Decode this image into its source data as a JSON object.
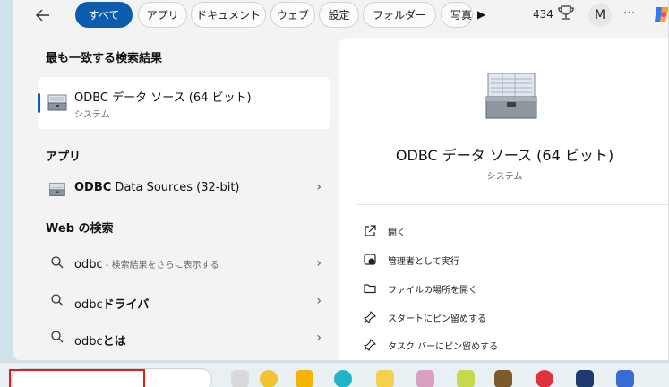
{
  "filters": {
    "all": "すべて",
    "apps": "アプリ",
    "documents": "ドキュメント",
    "web": "ウェブ",
    "settings": "設定",
    "folders": "フォルダー",
    "photos": "写真"
  },
  "header": {
    "points": "434",
    "avatar_initial": "M",
    "more": "···"
  },
  "left": {
    "best_match_title": "最も一致する検索結果",
    "best_match": {
      "title": "ODBC データ ソース (64 ビット)",
      "subtitle": "システム"
    },
    "apps_title": "アプリ",
    "apps": [
      {
        "name_bold": "ODBC",
        "name_rest": " Data Sources (32-bit)"
      }
    ],
    "web_title": "Web の検索",
    "web_results": [
      {
        "query": "odbc",
        "suffix": " - 検索結果をさらに表示する",
        "bold": ""
      },
      {
        "query": "odbc",
        "suffix": "",
        "bold": "ドライバ"
      },
      {
        "query": "odbc",
        "suffix": "",
        "bold": "とは"
      }
    ]
  },
  "right": {
    "title": "ODBC データ ソース (64 ビット)",
    "subtitle": "システム",
    "actions": [
      {
        "label": "開く",
        "icon": "open-external-icon"
      },
      {
        "label": "管理者として実行",
        "icon": "run-as-admin-icon"
      },
      {
        "label": "ファイルの場所を開く",
        "icon": "folder-icon"
      },
      {
        "label": "スタートにピン留めする",
        "icon": "pin-icon"
      },
      {
        "label": "タスク バーにピン留めする",
        "icon": "pin-icon"
      }
    ]
  },
  "colors": {
    "accent": "#0b5cad",
    "highlight": "#e01e1e"
  }
}
